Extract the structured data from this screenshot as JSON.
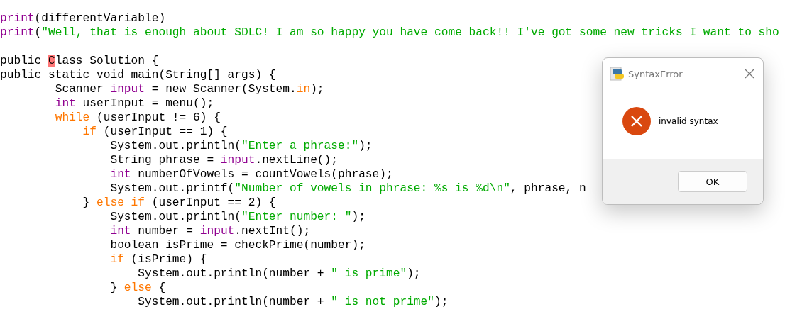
{
  "editor": {
    "lines": [
      {
        "kind": "code",
        "tokens": [
          {
            "text": "print",
            "kind": "builtin"
          },
          {
            "text": "(differentVariable)",
            "kind": "plain"
          }
        ]
      },
      {
        "kind": "code",
        "tokens": [
          {
            "text": "print",
            "kind": "builtin"
          },
          {
            "text": "(",
            "kind": "plain"
          },
          {
            "text": "\"Well, that is enough about SDLC! I am so happy you have come back!! I've got some new tricks I want to sho",
            "kind": "string"
          }
        ]
      },
      {
        "kind": "blank"
      },
      {
        "kind": "code",
        "tokens": [
          {
            "text": "public ",
            "kind": "plain"
          },
          {
            "text": "C",
            "kind": "error"
          },
          {
            "text": "lass Solution {",
            "kind": "plain"
          }
        ]
      },
      {
        "kind": "code",
        "tokens": [
          {
            "text": "public static void main(String[] args) {",
            "kind": "plain"
          }
        ],
        "children": [
          {
            "kind": "code",
            "tokens": [
              {
                "text": "Scanner ",
                "kind": "plain"
              },
              {
                "text": "input",
                "kind": "builtin"
              },
              {
                "text": " = new Scanner(System.",
                "kind": "plain"
              },
              {
                "text": "in",
                "kind": "keyword"
              },
              {
                "text": ");",
                "kind": "plain"
              }
            ]
          },
          {
            "kind": "code",
            "tokens": [
              {
                "text": "int",
                "kind": "builtin"
              },
              {
                "text": " userInput = menu();",
                "kind": "plain"
              }
            ]
          },
          {
            "kind": "code",
            "tokens": [
              {
                "text": "while",
                "kind": "keyword"
              },
              {
                "text": " (userInput != 6) {",
                "kind": "plain"
              }
            ],
            "children": [
              {
                "kind": "code",
                "tokens": [
                  {
                    "text": "if",
                    "kind": "keyword"
                  },
                  {
                    "text": " (userInput == 1) {",
                    "kind": "plain"
                  }
                ],
                "children": [
                  {
                    "kind": "code",
                    "tokens": [
                      {
                        "text": "System.out.println(",
                        "kind": "plain"
                      },
                      {
                        "text": "\"Enter a phrase:\"",
                        "kind": "string"
                      },
                      {
                        "text": ");",
                        "kind": "plain"
                      }
                    ]
                  },
                  {
                    "kind": "code",
                    "tokens": [
                      {
                        "text": "String phrase = ",
                        "kind": "plain"
                      },
                      {
                        "text": "input",
                        "kind": "builtin"
                      },
                      {
                        "text": ".nextLine();",
                        "kind": "plain"
                      }
                    ]
                  },
                  {
                    "kind": "code",
                    "tokens": [
                      {
                        "text": "int",
                        "kind": "builtin"
                      },
                      {
                        "text": " numberOfVowels = countVowels(phrase);",
                        "kind": "plain"
                      }
                    ]
                  },
                  {
                    "kind": "code",
                    "tokens": [
                      {
                        "text": "System.out.printf(",
                        "kind": "plain"
                      },
                      {
                        "text": "\"Number of vowels in phrase: %s is %d\\n\"",
                        "kind": "string"
                      },
                      {
                        "text": ", phrase, n",
                        "kind": "plain"
                      }
                    ]
                  }
                ]
              },
              {
                "kind": "code",
                "tokens": [
                  {
                    "text": "} ",
                    "kind": "plain"
                  },
                  {
                    "text": "else if",
                    "kind": "keyword"
                  },
                  {
                    "text": " (userInput == 2) {",
                    "kind": "plain"
                  }
                ],
                "children": [
                  {
                    "kind": "code",
                    "tokens": [
                      {
                        "text": "System.out.println(",
                        "kind": "plain"
                      },
                      {
                        "text": "\"Enter number: \"",
                        "kind": "string"
                      },
                      {
                        "text": ");",
                        "kind": "plain"
                      }
                    ]
                  },
                  {
                    "kind": "code",
                    "tokens": [
                      {
                        "text": "int",
                        "kind": "builtin"
                      },
                      {
                        "text": " number = ",
                        "kind": "plain"
                      },
                      {
                        "text": "input",
                        "kind": "builtin"
                      },
                      {
                        "text": ".nextInt();",
                        "kind": "plain"
                      }
                    ]
                  },
                  {
                    "kind": "code",
                    "tokens": [
                      {
                        "text": "boolean isPrime = checkPrime(number);",
                        "kind": "plain"
                      }
                    ]
                  },
                  {
                    "kind": "code",
                    "tokens": [
                      {
                        "text": "if",
                        "kind": "keyword"
                      },
                      {
                        "text": " (isPrime) {",
                        "kind": "plain"
                      }
                    ],
                    "children": [
                      {
                        "kind": "code",
                        "tokens": [
                          {
                            "text": "System.out.println(number + ",
                            "kind": "plain"
                          },
                          {
                            "text": "\" is prime\"",
                            "kind": "string"
                          },
                          {
                            "text": ");",
                            "kind": "plain"
                          }
                        ]
                      }
                    ]
                  },
                  {
                    "kind": "code",
                    "tokens": [
                      {
                        "text": "} ",
                        "kind": "plain"
                      },
                      {
                        "text": "else",
                        "kind": "keyword"
                      },
                      {
                        "text": " {",
                        "kind": "plain"
                      }
                    ],
                    "children": [
                      {
                        "kind": "code",
                        "tokens": [
                          {
                            "text": "System.out.println(number + ",
                            "kind": "plain"
                          },
                          {
                            "text": "\" is not prime\"",
                            "kind": "string"
                          },
                          {
                            "text": ");",
                            "kind": "plain"
                          }
                        ]
                      }
                    ]
                  }
                ]
              }
            ]
          }
        ]
      }
    ]
  },
  "dialog": {
    "title": "SyntaxError",
    "message": "invalid syntax",
    "button": "OK"
  }
}
